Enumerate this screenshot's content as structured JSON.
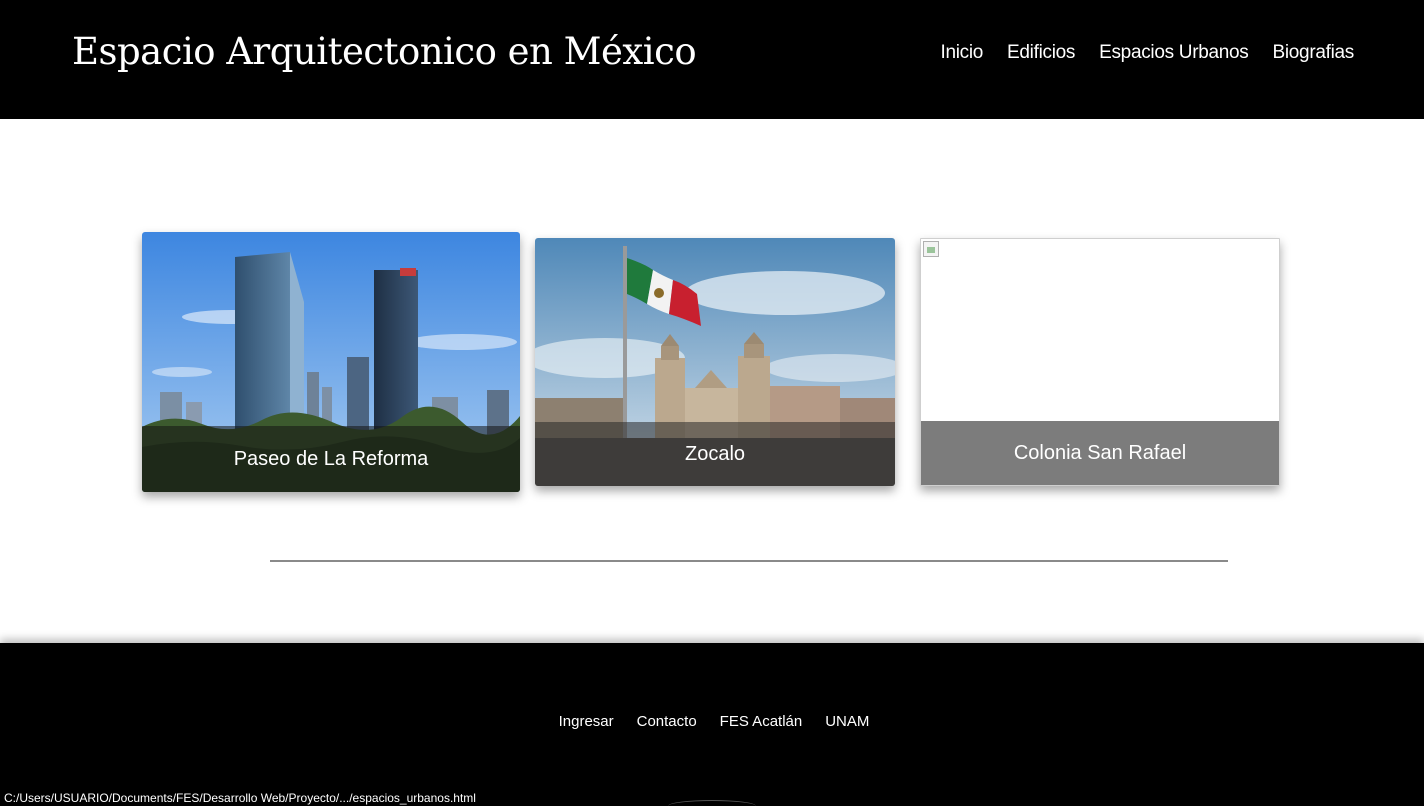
{
  "header": {
    "title": "Espacio Arquitectonico en México",
    "nav": [
      "Inicio",
      "Edificios",
      "Espacios Urbanos",
      "Biografias"
    ]
  },
  "cards": [
    {
      "caption": "Paseo de La Reforma",
      "image": "reforma-skyline-photo"
    },
    {
      "caption": "Zocalo",
      "image": "zocalo-cathedral-flag-photo"
    },
    {
      "caption": "Colonia San Rafael",
      "image": "broken-image-icon"
    }
  ],
  "footer": {
    "links": [
      "Ingresar",
      "Contacto",
      "FES Acatlán",
      "UNAM"
    ]
  },
  "status_bar": {
    "url": "C:/Users/USUARIO/Documents/FES/Desarrollo Web/Proyecto/.../espacios_urbanos.html"
  },
  "colors": {
    "header_bg": "#000000",
    "footer_bg": "#000000",
    "caption_gray": "#7c7c7c",
    "divider": "#8a8a8a"
  }
}
